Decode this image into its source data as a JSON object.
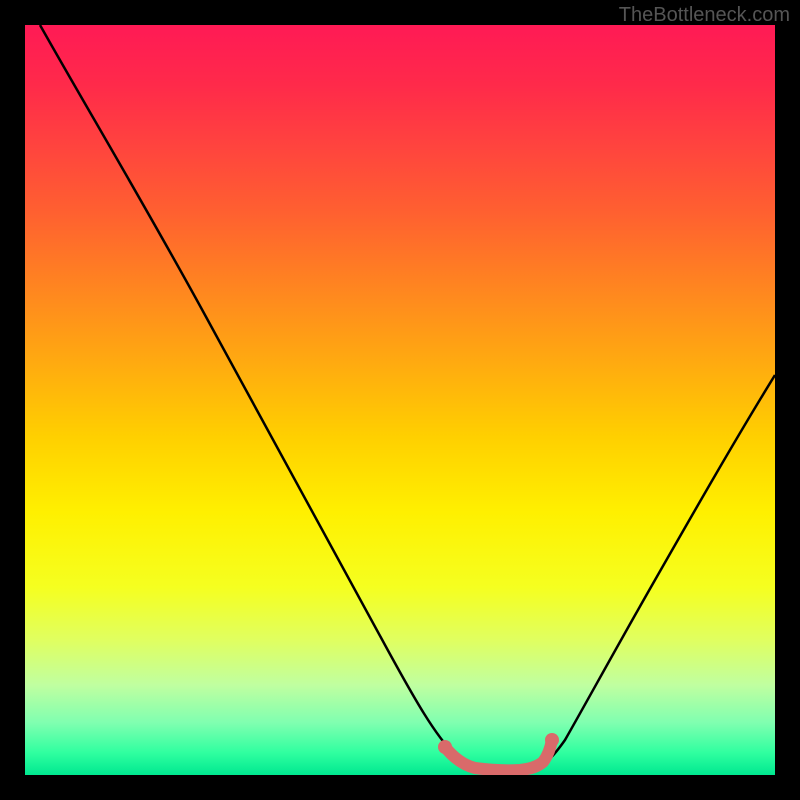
{
  "watermark": "TheBottleneck.com",
  "chart_data": {
    "type": "line",
    "title": "",
    "xlabel": "",
    "ylabel": "",
    "xlim": [
      0,
      100
    ],
    "ylim": [
      0,
      100
    ],
    "series": [
      {
        "name": "bottleneck-curve",
        "x": [
          2,
          10,
          20,
          30,
          40,
          50,
          55,
          58,
          60,
          65,
          68,
          70,
          75,
          80,
          85,
          90,
          95,
          100
        ],
        "y": [
          100,
          88,
          72,
          56,
          40,
          22,
          10,
          4,
          2,
          1,
          1,
          2,
          5,
          12,
          22,
          33,
          44,
          55
        ]
      }
    ],
    "highlight_region": {
      "name": "optimal-zone",
      "x": [
        56,
        58,
        60,
        63,
        66,
        68,
        69
      ],
      "y": [
        5,
        3,
        2,
        1.5,
        1.5,
        2,
        4
      ]
    },
    "gradient_stops": [
      {
        "pos": 0,
        "color": "#ff1a55"
      },
      {
        "pos": 50,
        "color": "#ffd000"
      },
      {
        "pos": 100,
        "color": "#00e890"
      }
    ]
  }
}
